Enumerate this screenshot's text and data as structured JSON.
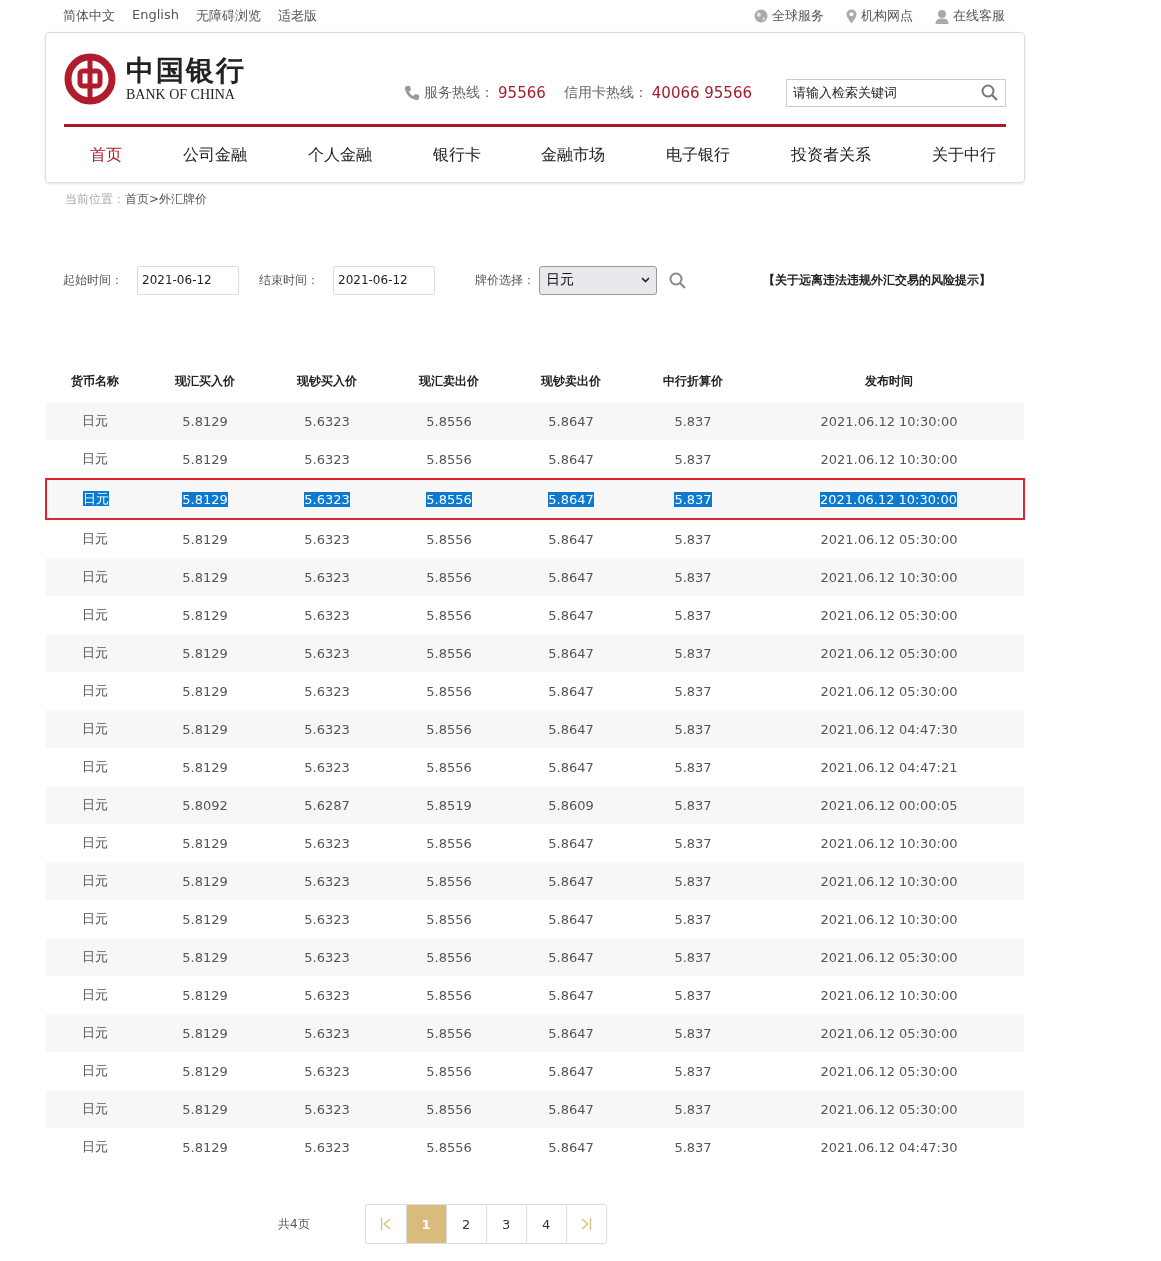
{
  "top_links": [
    "简体中文",
    "English",
    "无障碍浏览",
    "适老版"
  ],
  "top_services": [
    {
      "kind": "globe",
      "label": "全球服务"
    },
    {
      "kind": "pin",
      "label": "机构网点"
    },
    {
      "kind": "person",
      "label": "在线客服"
    }
  ],
  "logo": {
    "chinese": "中国银行",
    "english": "BANK OF CHINA"
  },
  "hotlines": [
    {
      "label": "服务热线：",
      "number": "95566"
    },
    {
      "label": "信用卡热线：",
      "number": "40066 95566"
    }
  ],
  "search": {
    "value": "请输入检索关键词"
  },
  "nav": [
    {
      "label": "首页",
      "selected": true
    },
    {
      "label": "公司金融",
      "selected": false
    },
    {
      "label": "个人金融",
      "selected": false
    },
    {
      "label": "银行卡",
      "selected": false
    },
    {
      "label": "金融市场",
      "selected": false
    },
    {
      "label": "电子银行",
      "selected": false
    },
    {
      "label": "投资者关系",
      "selected": false
    },
    {
      "label": "关于中行",
      "selected": false
    }
  ],
  "breadcrumb": {
    "label": "当前位置：",
    "path": "首页>外汇牌价"
  },
  "filters": {
    "start_label": "起始时间：",
    "start_value": "2021-06-12",
    "end_label": "结束时间：",
    "end_value": "2021-06-12",
    "currency_label": "牌价选择：",
    "currency_value": "日元",
    "risk_link": "【关于远离违法违规外汇交易的风险提示】"
  },
  "table": {
    "columns": [
      "货币名称",
      "现汇买入价",
      "现钞买入价",
      "现汇卖出价",
      "现钞卖出价",
      "中行折算价",
      "发布时间"
    ],
    "rows": [
      {
        "selected": false,
        "cells": [
          "日元",
          "5.8129",
          "5.6323",
          "5.8556",
          "5.8647",
          "5.837",
          "2021.06.12 10:30:00"
        ]
      },
      {
        "selected": false,
        "cells": [
          "日元",
          "5.8129",
          "5.6323",
          "5.8556",
          "5.8647",
          "5.837",
          "2021.06.12 10:30:00"
        ]
      },
      {
        "selected": true,
        "cells": [
          "日元",
          "5.8129",
          "5.6323",
          "5.8556",
          "5.8647",
          "5.837",
          "2021.06.12 10:30:00"
        ]
      },
      {
        "selected": false,
        "cells": [
          "日元",
          "5.8129",
          "5.6323",
          "5.8556",
          "5.8647",
          "5.837",
          "2021.06.12 05:30:00"
        ]
      },
      {
        "selected": false,
        "cells": [
          "日元",
          "5.8129",
          "5.6323",
          "5.8556",
          "5.8647",
          "5.837",
          "2021.06.12 10:30:00"
        ]
      },
      {
        "selected": false,
        "cells": [
          "日元",
          "5.8129",
          "5.6323",
          "5.8556",
          "5.8647",
          "5.837",
          "2021.06.12 05:30:00"
        ]
      },
      {
        "selected": false,
        "cells": [
          "日元",
          "5.8129",
          "5.6323",
          "5.8556",
          "5.8647",
          "5.837",
          "2021.06.12 05:30:00"
        ]
      },
      {
        "selected": false,
        "cells": [
          "日元",
          "5.8129",
          "5.6323",
          "5.8556",
          "5.8647",
          "5.837",
          "2021.06.12 05:30:00"
        ]
      },
      {
        "selected": false,
        "cells": [
          "日元",
          "5.8129",
          "5.6323",
          "5.8556",
          "5.8647",
          "5.837",
          "2021.06.12 04:47:30"
        ]
      },
      {
        "selected": false,
        "cells": [
          "日元",
          "5.8129",
          "5.6323",
          "5.8556",
          "5.8647",
          "5.837",
          "2021.06.12 04:47:21"
        ]
      },
      {
        "selected": false,
        "cells": [
          "日元",
          "5.8092",
          "5.6287",
          "5.8519",
          "5.8609",
          "5.837",
          "2021.06.12 00:00:05"
        ]
      },
      {
        "selected": false,
        "cells": [
          "日元",
          "5.8129",
          "5.6323",
          "5.8556",
          "5.8647",
          "5.837",
          "2021.06.12 10:30:00"
        ]
      },
      {
        "selected": false,
        "cells": [
          "日元",
          "5.8129",
          "5.6323",
          "5.8556",
          "5.8647",
          "5.837",
          "2021.06.12 10:30:00"
        ]
      },
      {
        "selected": false,
        "cells": [
          "日元",
          "5.8129",
          "5.6323",
          "5.8556",
          "5.8647",
          "5.837",
          "2021.06.12 10:30:00"
        ]
      },
      {
        "selected": false,
        "cells": [
          "日元",
          "5.8129",
          "5.6323",
          "5.8556",
          "5.8647",
          "5.837",
          "2021.06.12 05:30:00"
        ]
      },
      {
        "selected": false,
        "cells": [
          "日元",
          "5.8129",
          "5.6323",
          "5.8556",
          "5.8647",
          "5.837",
          "2021.06.12 10:30:00"
        ]
      },
      {
        "selected": false,
        "cells": [
          "日元",
          "5.8129",
          "5.6323",
          "5.8556",
          "5.8647",
          "5.837",
          "2021.06.12 05:30:00"
        ]
      },
      {
        "selected": false,
        "cells": [
          "日元",
          "5.8129",
          "5.6323",
          "5.8556",
          "5.8647",
          "5.837",
          "2021.06.12 05:30:00"
        ]
      },
      {
        "selected": false,
        "cells": [
          "日元",
          "5.8129",
          "5.6323",
          "5.8556",
          "5.8647",
          "5.837",
          "2021.06.12 05:30:00"
        ]
      },
      {
        "selected": false,
        "cells": [
          "日元",
          "5.8129",
          "5.6323",
          "5.8556",
          "5.8647",
          "5.837",
          "2021.06.12 04:47:30"
        ]
      }
    ]
  },
  "pagination": {
    "total": "共4页",
    "pages": [
      {
        "label": "1",
        "selected": true
      },
      {
        "label": "2",
        "selected": false
      },
      {
        "label": "3",
        "selected": false
      },
      {
        "label": "4",
        "selected": false
      }
    ]
  }
}
